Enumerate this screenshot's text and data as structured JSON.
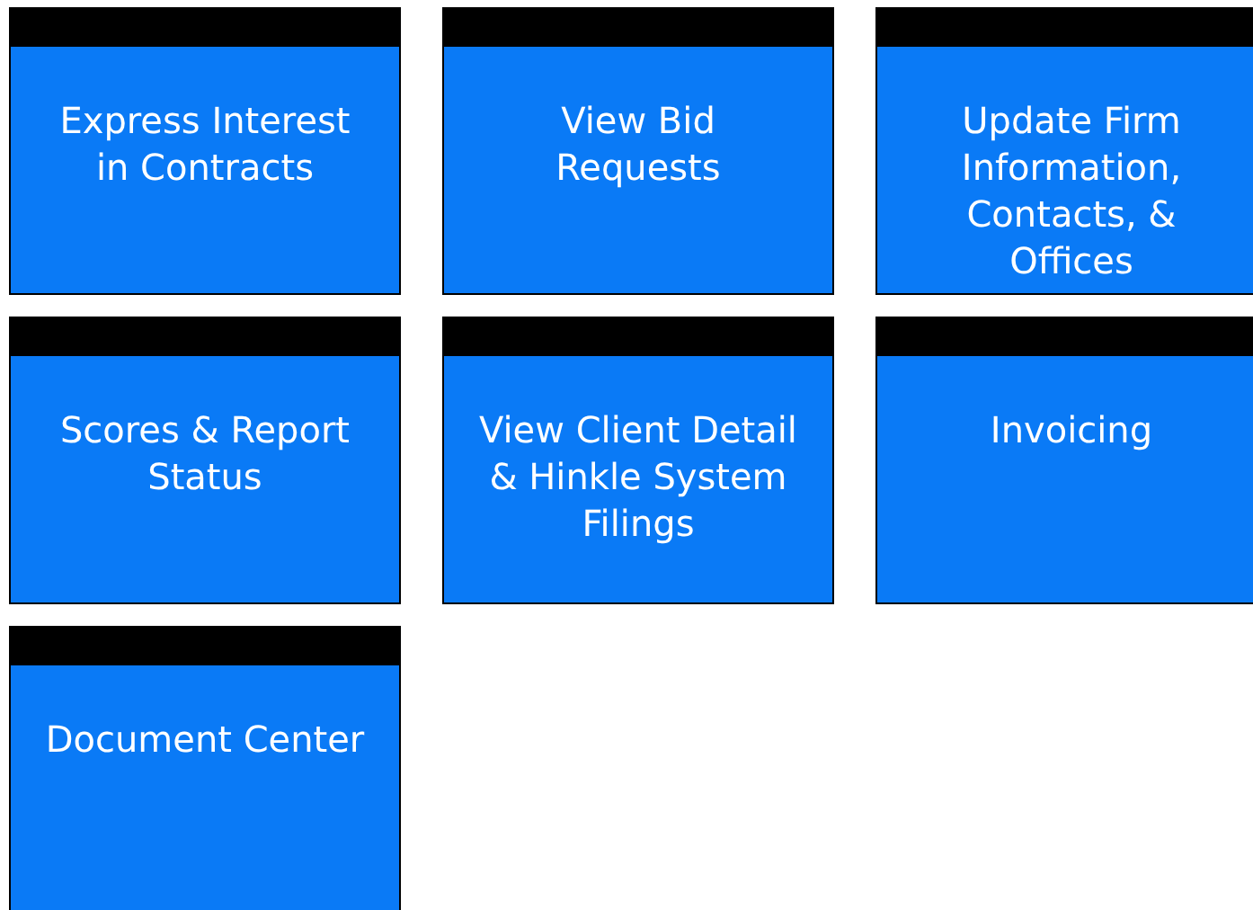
{
  "tiles": [
    {
      "lines": [
        "Express Interest",
        "in Contracts"
      ]
    },
    {
      "lines": [
        "View Bid",
        "Requests"
      ]
    },
    {
      "lines": [
        "Update Firm",
        "Information,",
        "Contacts, &",
        "Offices"
      ]
    },
    {
      "lines": [
        "Scores & Report",
        "Status"
      ]
    },
    {
      "lines": [
        "View Client Detail",
        "& Hinkle System",
        "Filings"
      ]
    },
    {
      "lines": [
        "Invoicing"
      ]
    },
    {
      "lines": [
        "Document Center"
      ]
    }
  ]
}
